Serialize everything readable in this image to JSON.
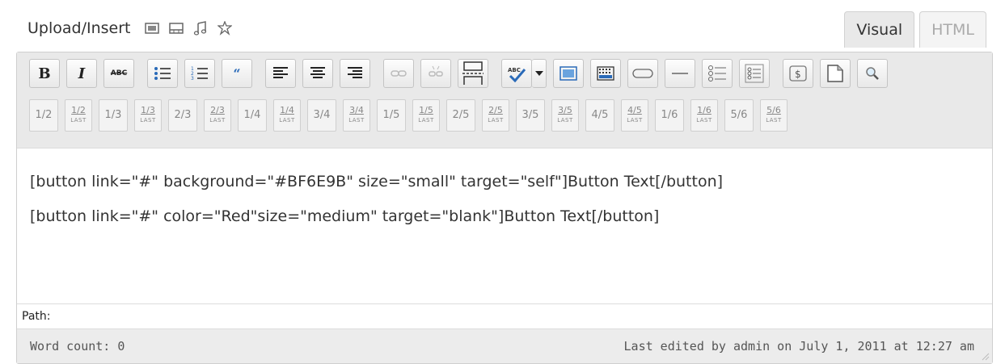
{
  "media": {
    "label": "Upload/Insert",
    "icons": [
      "image-icon",
      "video-icon",
      "audio-icon",
      "media-icon"
    ]
  },
  "tabs": [
    {
      "label": "Visual",
      "active": true
    },
    {
      "label": "HTML",
      "active": false
    }
  ],
  "toolbar": {
    "row1": [
      {
        "name": "bold",
        "label": "B"
      },
      {
        "name": "italic",
        "label": "I"
      },
      {
        "name": "strikethrough",
        "label": "ABC"
      },
      {
        "name": "bullet-list"
      },
      {
        "name": "numbered-list"
      },
      {
        "name": "blockquote",
        "label": "66"
      },
      {
        "name": "align-left"
      },
      {
        "name": "align-center"
      },
      {
        "name": "align-right"
      },
      {
        "name": "insert-link"
      },
      {
        "name": "unlink"
      },
      {
        "name": "insert-more"
      },
      {
        "name": "spellcheck",
        "label": "ABC"
      },
      {
        "name": "spellcheck-dropdown"
      },
      {
        "name": "fullscreen"
      },
      {
        "name": "toggle-kitchen-sink"
      },
      {
        "name": "button-shortcode"
      },
      {
        "name": "divider-shortcode"
      },
      {
        "name": "list-shortcode"
      },
      {
        "name": "list-alt-shortcode"
      },
      {
        "name": "price-shortcode",
        "label": "$"
      },
      {
        "name": "page-shortcode"
      },
      {
        "name": "search-replace"
      }
    ],
    "row2": [
      {
        "label": "1/2",
        "last": false
      },
      {
        "label": "1/2",
        "last": true
      },
      {
        "label": "1/3",
        "last": false
      },
      {
        "label": "1/3",
        "last": true
      },
      {
        "label": "2/3",
        "last": false
      },
      {
        "label": "2/3",
        "last": true
      },
      {
        "label": "1/4",
        "last": false
      },
      {
        "label": "1/4",
        "last": true
      },
      {
        "label": "3/4",
        "last": false
      },
      {
        "label": "3/4",
        "last": true
      },
      {
        "label": "1/5",
        "last": false
      },
      {
        "label": "1/5",
        "last": true
      },
      {
        "label": "2/5",
        "last": false
      },
      {
        "label": "2/5",
        "last": true
      },
      {
        "label": "3/5",
        "last": false
      },
      {
        "label": "3/5",
        "last": true
      },
      {
        "label": "4/5",
        "last": false
      },
      {
        "label": "4/5",
        "last": true
      },
      {
        "label": "1/6",
        "last": false
      },
      {
        "label": "1/6",
        "last": true
      },
      {
        "label": "5/6",
        "last": false
      },
      {
        "label": "5/6",
        "last": true
      }
    ],
    "last_text": "LAST"
  },
  "content": {
    "line1": "[button link=\"#\" background=\"#BF6E9B\" size=\"small\" target=\"self\"]Button Text[/button]",
    "line2": "[button link=\"#\" color=\"Red\"size=\"medium\" target=\"blank\"]Button Text[/button]"
  },
  "path": {
    "label": "Path:"
  },
  "status": {
    "word_count": "Word count: 0",
    "last_edited": "Last edited by admin on July 1, 2011 at 12:27 am"
  },
  "colors": {
    "toolbar_bg": "#e9e9e9",
    "border": "#cfcfcf",
    "text": "#333333"
  }
}
